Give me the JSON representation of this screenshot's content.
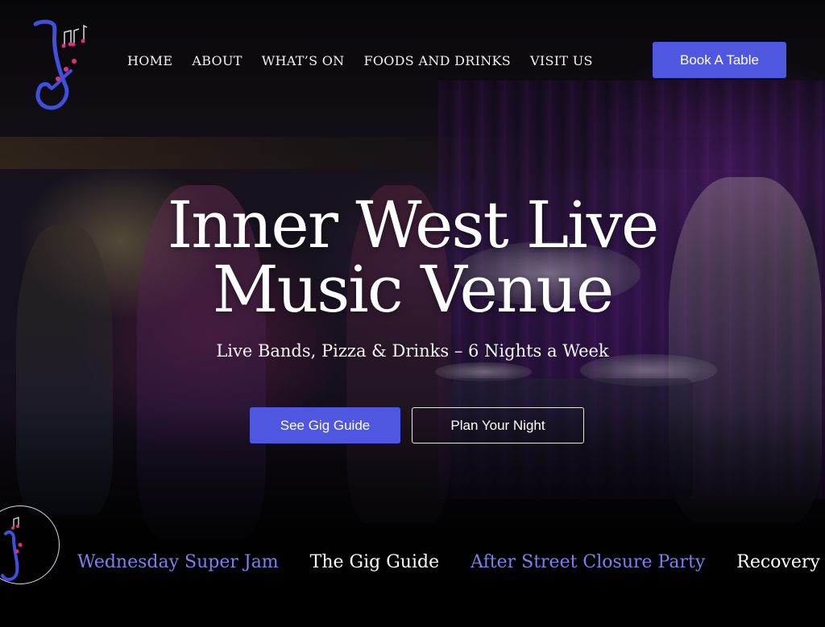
{
  "colors": {
    "accent": "#4f56e0",
    "ticker_highlight": "#7b80f0",
    "ticker_normal": "#ffffff",
    "logo_blue": "#3f4fe0",
    "logo_pink": "#e0307a"
  },
  "header": {
    "logo_icon": "saxophone-music-notes-logo",
    "nav": [
      {
        "label": "HOME"
      },
      {
        "label": "ABOUT"
      },
      {
        "label": "WHAT’S ON"
      },
      {
        "label": "FOODS AND DRINKS"
      },
      {
        "label": "VISIT US"
      }
    ],
    "book_button": "Book A Table"
  },
  "hero": {
    "title_line1": "Inner West Live",
    "title_line2": "Music Venue",
    "subtitle": "Live Bands, Pizza & Drinks – 6 Nights a Week",
    "primary_button": "See Gig Guide",
    "secondary_button": "Plan Your Night"
  },
  "ticker": {
    "items": [
      {
        "label": "Wednesday Super Jam",
        "highlight": true
      },
      {
        "label": "The Gig Guide",
        "highlight": false
      },
      {
        "label": "After Street Closure Party",
        "highlight": true
      },
      {
        "label": "Recovery for t",
        "highlight": false
      }
    ]
  }
}
